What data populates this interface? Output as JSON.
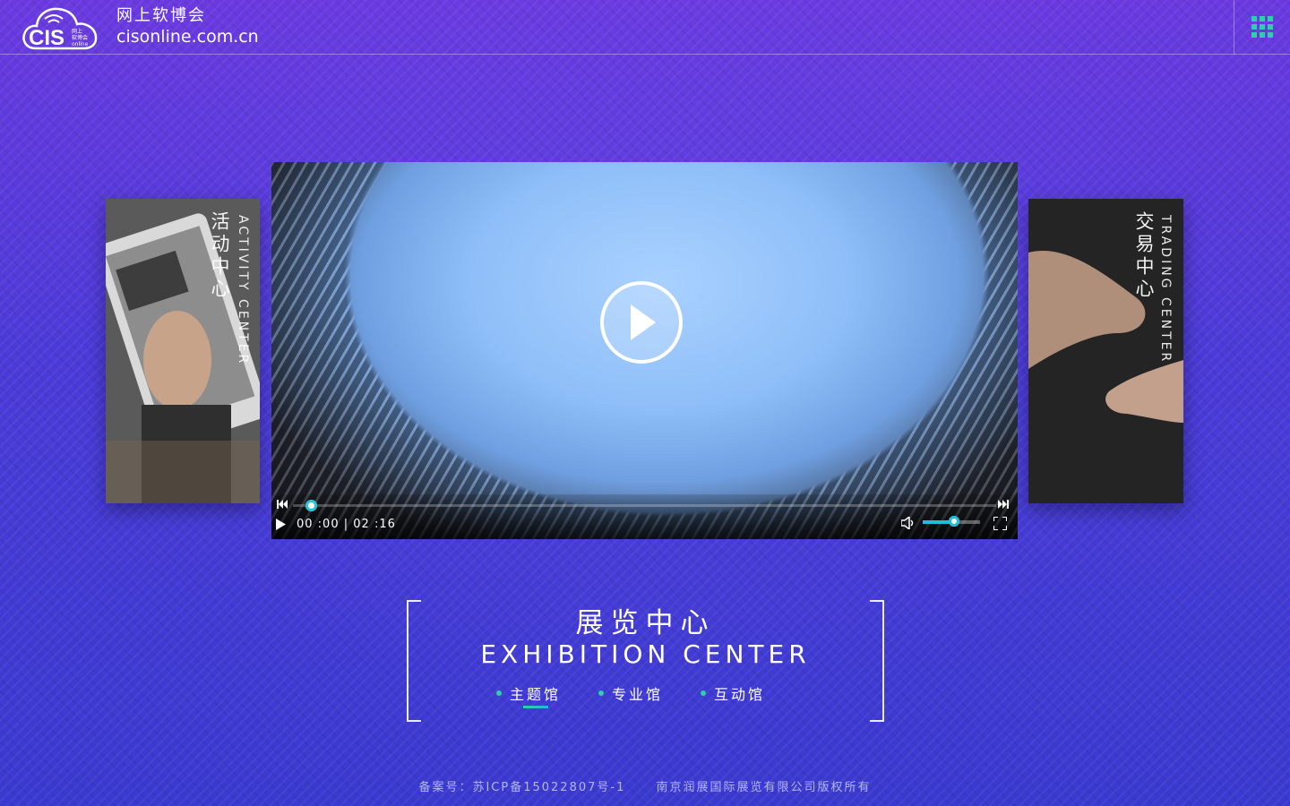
{
  "header": {
    "logo_text": "CIS",
    "logo_sub": [
      "网上",
      "软博会",
      "online"
    ],
    "brand_cn": "网上软博会",
    "brand_url": "cisonline.com.cn",
    "menu_icon": "grid-menu-icon"
  },
  "left_panel": {
    "title_cn": "活动中心",
    "title_en": "ACTIVITY CENTER"
  },
  "right_panel": {
    "title_cn": "交易中心",
    "title_en": "TRADING CENTER"
  },
  "video": {
    "current_time": "00 :00",
    "separator": "|",
    "duration": "02 :16",
    "progress": 0.0,
    "volume": 0.55
  },
  "exhibition": {
    "title_cn": "展览中心",
    "title_en": "EXHIBITION CENTER",
    "tabs": [
      {
        "label": "主题馆",
        "active": true
      },
      {
        "label": "专业馆",
        "active": false
      },
      {
        "label": "互动馆",
        "active": false
      }
    ]
  },
  "footer": {
    "icp": "备案号：苏ICP备15022807号-1",
    "copyright": "南京润展国际展览有限公司版权所有"
  },
  "colors": {
    "accent": "#1dbed7",
    "tab_dot": "#2ad3a5",
    "bg_top": "#6a3ae0",
    "bg_bottom": "#3a3ad0"
  }
}
